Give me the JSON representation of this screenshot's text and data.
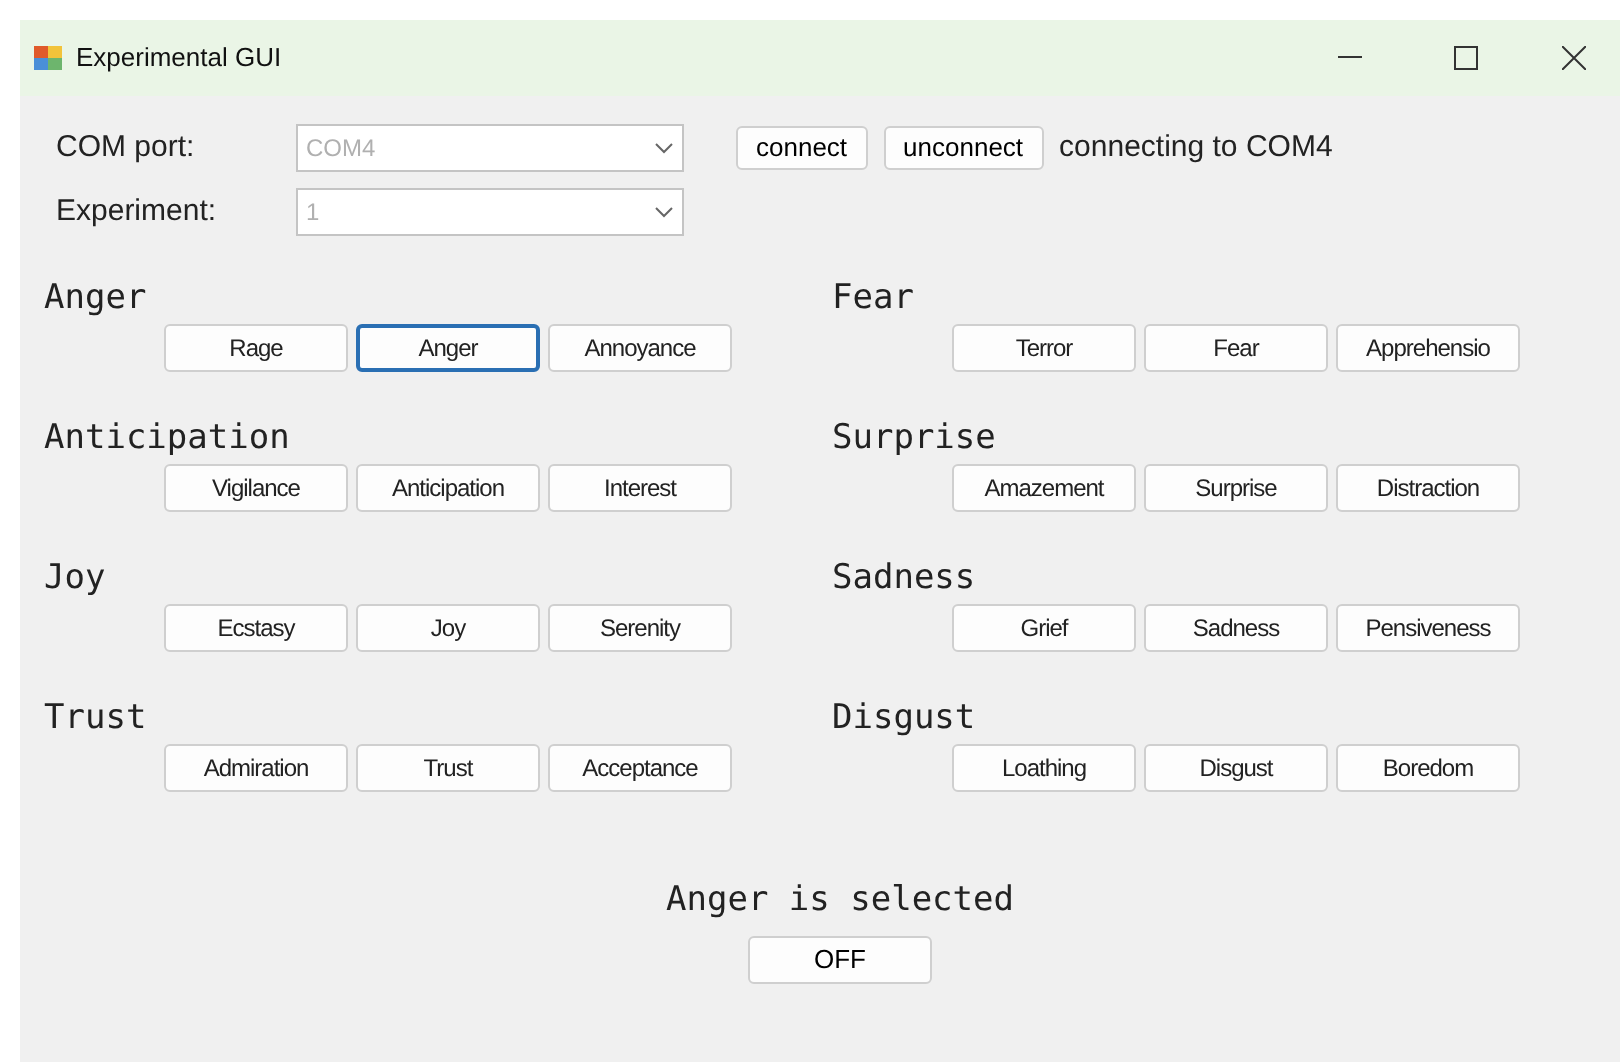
{
  "window": {
    "title": "Experimental GUI"
  },
  "com_port": {
    "label": "COM port:",
    "value": "COM4",
    "disabled": true
  },
  "experiment": {
    "label": "Experiment:",
    "value": "1",
    "disabled": true
  },
  "buttons": [
    "connect",
    "unconnect"
  ],
  "connection_status": "connecting to COM4",
  "columns": [
    [
      {
        "title": "Anger",
        "options": [
          {
            "label": "Rage",
            "selected": false
          },
          {
            "label": "Anger",
            "selected": true
          },
          {
            "label": "Annoyance",
            "selected": false
          }
        ]
      },
      {
        "title": "Anticipation",
        "options": [
          {
            "label": "Vigilance",
            "selected": false
          },
          {
            "label": "Anticipation",
            "selected": false
          },
          {
            "label": "Interest",
            "selected": false
          }
        ]
      },
      {
        "title": "Joy",
        "options": [
          {
            "label": "Ecstasy",
            "selected": false
          },
          {
            "label": "Joy",
            "selected": false
          },
          {
            "label": "Serenity",
            "selected": false
          }
        ]
      },
      {
        "title": "Trust",
        "options": [
          {
            "label": "Admiration",
            "selected": false
          },
          {
            "label": "Trust",
            "selected": false
          },
          {
            "label": "Acceptance",
            "selected": false
          }
        ]
      }
    ],
    [
      {
        "title": "Fear",
        "options": [
          {
            "label": "Terror",
            "selected": false
          },
          {
            "label": "Fear",
            "selected": false
          },
          {
            "label": "Apprehensio",
            "selected": false
          }
        ]
      },
      {
        "title": "Surprise",
        "options": [
          {
            "label": "Amazement",
            "selected": false
          },
          {
            "label": "Surprise",
            "selected": false
          },
          {
            "label": "Distraction",
            "selected": false
          }
        ]
      },
      {
        "title": "Sadness",
        "options": [
          {
            "label": "Grief",
            "selected": false
          },
          {
            "label": "Sadness",
            "selected": false
          },
          {
            "label": "Pensiveness",
            "selected": false
          }
        ]
      },
      {
        "title": "Disgust",
        "options": [
          {
            "label": "Loathing",
            "selected": false
          },
          {
            "label": "Disgust",
            "selected": false
          },
          {
            "label": "Boredom",
            "selected": false
          }
        ]
      }
    ]
  ],
  "selection_status": "Anger is selected",
  "toggle_button": "OFF"
}
